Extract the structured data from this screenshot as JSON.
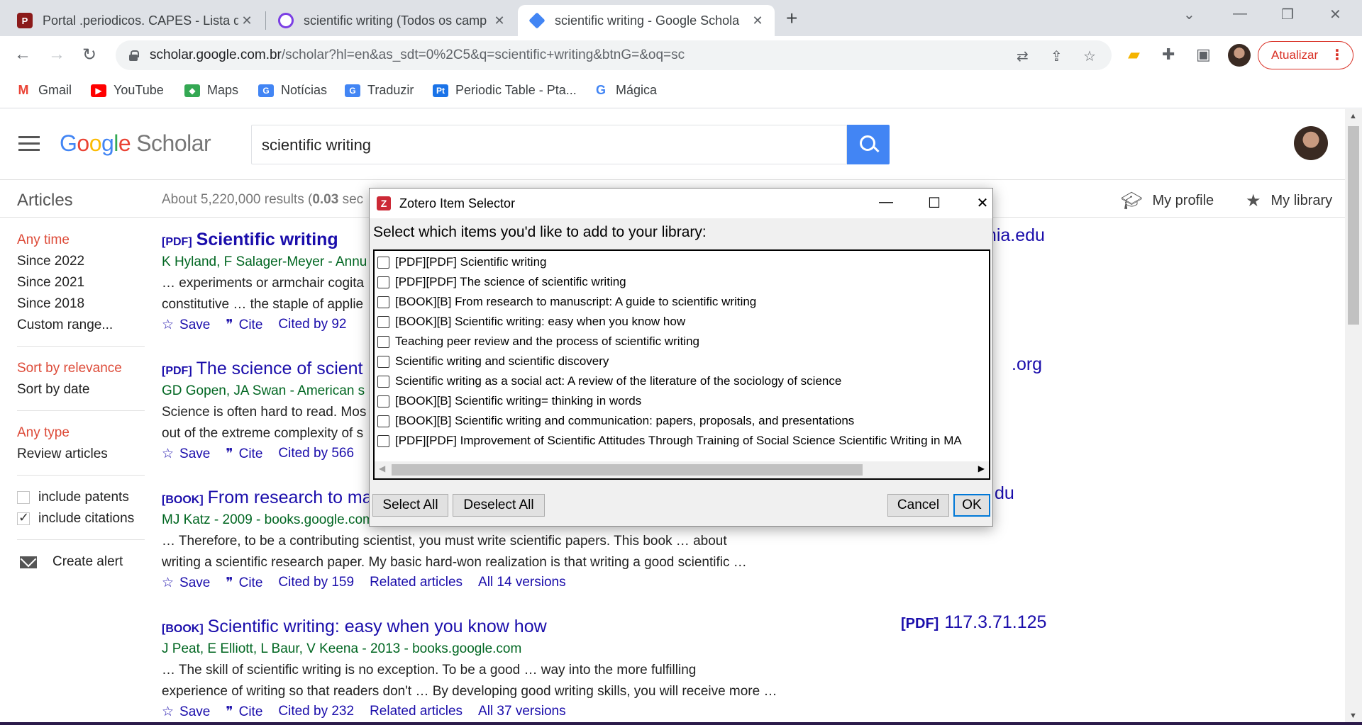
{
  "browser": {
    "tabs": [
      {
        "title": "Portal .periodicos. CAPES - Lista d",
        "active": false,
        "icon": "capes-icon"
      },
      {
        "title": "scientific writing (Todos os camp",
        "active": false,
        "icon": "refine-icon"
      },
      {
        "title": "scientific writing - Google Schola",
        "active": true,
        "icon": "scholar-icon"
      }
    ],
    "url_host": "scholar.google.com.br",
    "url_path": "/scholar?hl=en&as_sdt=0%2C5&q=scientific+writing&btnG=&oq=sc",
    "update_label": "Atualizar",
    "bookmarks": [
      {
        "label": "Gmail",
        "icon": "gmail-icon",
        "color": "#ea4335"
      },
      {
        "label": "YouTube",
        "icon": "youtube-icon",
        "color": "#ff0000"
      },
      {
        "label": "Maps",
        "icon": "maps-icon",
        "color": "#34a853"
      },
      {
        "label": "Notícias",
        "icon": "news-icon",
        "color": "#4285f4"
      },
      {
        "label": "Traduzir",
        "icon": "translate-icon",
        "color": "#4285f4"
      },
      {
        "label": "Periodic Table - Pta...",
        "icon": "periodic-table-icon",
        "color": "#1a73e8"
      },
      {
        "label": "Mágica",
        "icon": "google-icon",
        "color": "#4285f4"
      }
    ]
  },
  "scholar": {
    "logo_google": "Google",
    "logo_scholar": "Scholar",
    "query": "scientific writing",
    "articles_label": "Articles",
    "results_count": "About 5,220,000 results (",
    "results_time": "0.03",
    "results_suffix": " sec",
    "my_profile": "My profile",
    "my_library": "My library",
    "sidebar": {
      "time_filters": [
        "Any time",
        "Since 2022",
        "Since 2021",
        "Since 2018",
        "Custom range..."
      ],
      "sort": [
        "Sort by relevance",
        "Sort by date"
      ],
      "type": [
        "Any type",
        "Review articles"
      ],
      "include_patents": "include patents",
      "include_citations": "include citations",
      "create_alert": "Create alert"
    },
    "results": [
      {
        "tag": "[PDF]",
        "title": "Scientific writing",
        "authors": "K Hyland, F Salager-Meyer - Annu",
        "snippet1": "… experiments or armchair cogita",
        "snippet2": "constitutive … the staple of applie",
        "save": "Save",
        "cite": "Cite",
        "cited": "Cited by 92",
        "side": "mia.edu"
      },
      {
        "tag": "[PDF]",
        "title": "The science of scient",
        "authors": "GD Gopen, JA Swan - American s",
        "snippet1": "Science is often hard to read. Mos",
        "snippet2": "out of the extreme complexity of s",
        "save": "Save",
        "cite": "Cite",
        "cited": "Cited by 566",
        "side": ".org"
      },
      {
        "tag": "[BOOK]",
        "title": "From research to ma",
        "authors": "MJ Katz - 2009 - books.google.com",
        "snippet1": "… Therefore, to be a contributing scientist, you must write scientific papers. This book … about",
        "snippet2": "writing a scientific research paper. My basic hard-won realization is that writing a good scientific …",
        "save": "Save",
        "cite": "Cite",
        "cited": "Cited by 159",
        "related": "Related articles",
        "versions": "All 14 versions",
        "side": "du"
      },
      {
        "tag": "[BOOK]",
        "title": "Scientific writing: easy when you know how",
        "authors": "J Peat, E Elliott, L Baur, V Keena - 2013 - books.google.com",
        "snippet1": "… The skill of scientific writing is no exception. To be a good … way into the more fulfilling",
        "snippet2": "experience of writing so that readers don't … By developing good writing skills, you will receive more …",
        "save": "Save",
        "cite": "Cite",
        "cited": "Cited by 232",
        "related": "Related articles",
        "versions": "All 37 versions",
        "side_tag": "[PDF]",
        "side": "117.3.71.125"
      }
    ]
  },
  "zotero": {
    "title": "Zotero Item Selector",
    "prompt": "Select which items you'd like to add to your library:",
    "items": [
      "[PDF][PDF] Scientific writing",
      "[PDF][PDF] The science of scientific writing",
      "[BOOK][B] From research to manuscript: A guide to scientific writing",
      "[BOOK][B] Scientific writing: easy when you know how",
      "Teaching peer review and the process of scientific writing",
      "Scientific writing and scientific discovery",
      "Scientific writing as a social act: A review of the literature of the sociology of science",
      "[BOOK][B] Scientific writing= thinking in words",
      "[BOOK][B] Scientific writing and communication: papers, proposals, and presentations",
      "[PDF][PDF] Improvement of Scientific Attitudes Through Training of Social Science Scientific Writing in MA"
    ],
    "select_all": "Select All",
    "deselect_all": "Deselect All",
    "cancel": "Cancel",
    "ok": "OK"
  }
}
